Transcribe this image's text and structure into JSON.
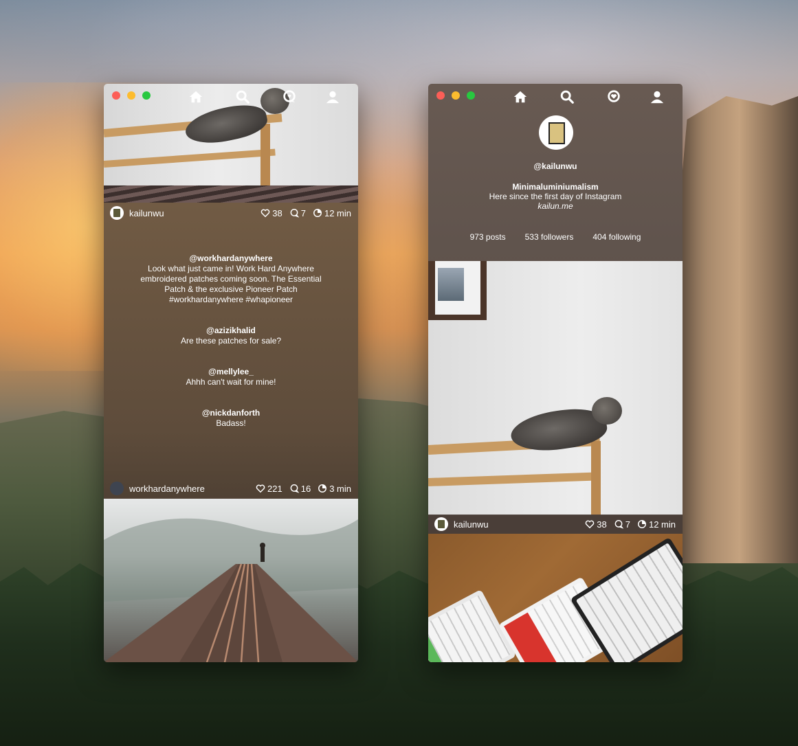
{
  "desktop": {
    "wallpaper": "mountain-sunset-wallpaper"
  },
  "window_feed": {
    "nav": [
      "home-icon",
      "search-icon",
      "activity-icon",
      "profile-icon"
    ],
    "post1": {
      "username": "kailunwu",
      "likes": "38",
      "comments": "7",
      "time": "12 min"
    },
    "comments": [
      {
        "author": "@workhardanywhere",
        "text": "Look what just came in! Work Hard Anywhere embroidered patches coming soon. The Essential Patch & the exclusive Pioneer Patch #workhardanywhere #whapioneer"
      },
      {
        "author": "@azizikhalid",
        "text": "Are these patches for sale?"
      },
      {
        "author": "@mellylee_",
        "text": "Ahhh can't wait for mine!"
      },
      {
        "author": "@nickdanforth",
        "text": "Badass!"
      }
    ],
    "post2": {
      "username": "workhardanywhere",
      "likes": "221",
      "comments": "16",
      "time": "3 min"
    }
  },
  "window_profile": {
    "nav": [
      "home-icon",
      "search-icon",
      "activity-icon",
      "profile-icon"
    ],
    "handle": "@kailunwu",
    "name": "Minimaluminiumalism",
    "bio": "Here since the first day of Instagram",
    "link": "kailun.me",
    "counts": {
      "posts": "973 posts",
      "followers": "533 followers",
      "following": "404 following"
    },
    "post": {
      "username": "kailunwu",
      "likes": "38",
      "comments": "7",
      "time": "12 min"
    }
  },
  "colors": {
    "close": "#fc5e57",
    "minimize": "#fdbc2e",
    "maximize": "#28c840"
  }
}
